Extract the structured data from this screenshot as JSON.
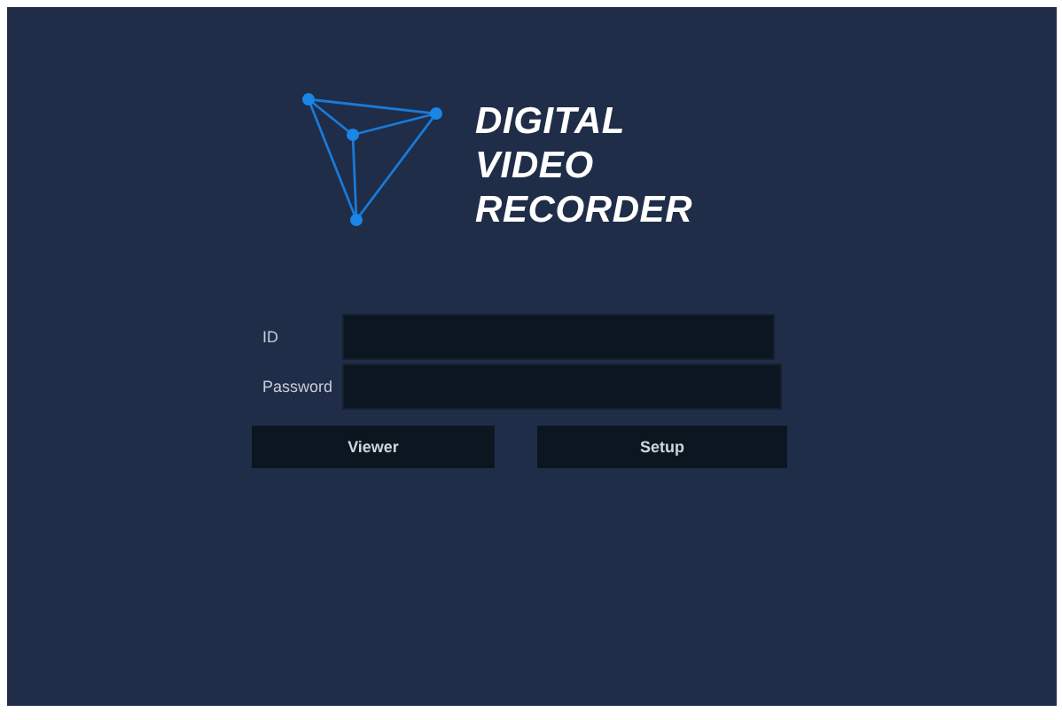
{
  "logo": {
    "lines": [
      "DIGITAL",
      "VIDEO",
      "RECORDER"
    ]
  },
  "fields": [
    {
      "label": "ID"
    },
    {
      "label": "Password"
    }
  ],
  "buttons": [
    "Viewer",
    "Setup"
  ]
}
